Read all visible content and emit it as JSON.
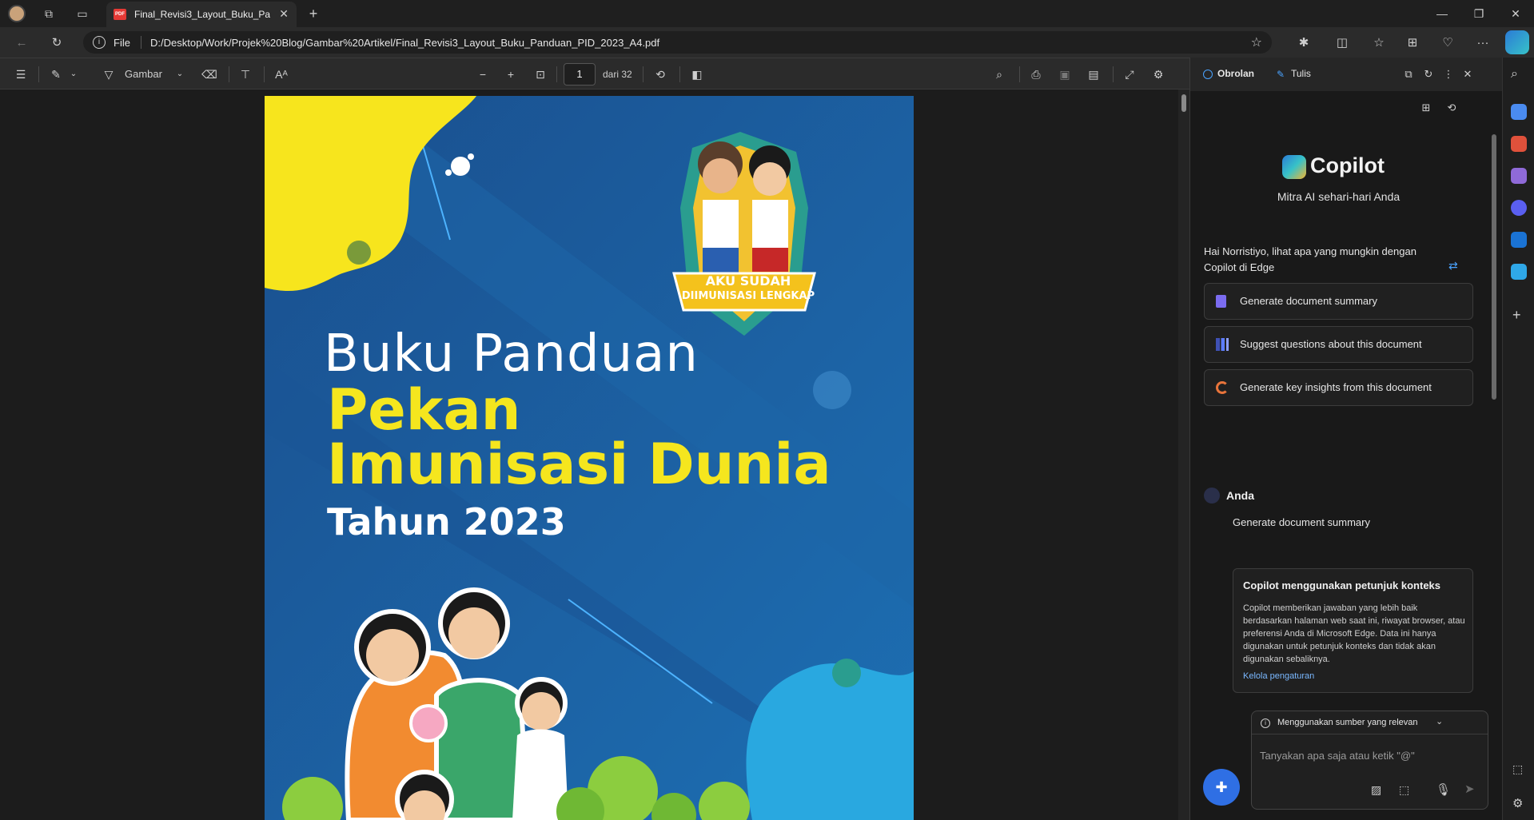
{
  "browser": {
    "tab_title": "Final_Revisi3_Layout_Buku_Panduan_PID_2023_A4.pdf",
    "address_scheme": "File",
    "address_url": "D:/Desktop/Work/Projek%20Blog/Gambar%20Artikel/Final_Revisi3_Layout_Buku_Panduan_PID_2023_A4.pdf"
  },
  "pdf_toolbar": {
    "draw_label": "Gambar",
    "page_current": "1",
    "page_total_label": "dari 32"
  },
  "pdf_page": {
    "title_line1": "Buku Panduan",
    "title_line2": "Pekan",
    "title_line3": "Imunisasi Dunia",
    "title_line4": "Tahun 2023",
    "badge_line1": "AKU SUDAH",
    "badge_line2": "DIIMUNISASI LENGKAP"
  },
  "copilot": {
    "tab_chat": "Obrolan",
    "tab_write": "Tulis",
    "brand": "Copilot",
    "tagline": "Mitra AI sehari-hari Anda",
    "greeting": "Hai Norristiyo, lihat apa yang mungkin dengan Copilot di Edge",
    "suggestions": [
      "Generate document summary",
      "Suggest questions about this document",
      "Generate key insights from this document"
    ],
    "user_name": "Anda",
    "user_message": "Generate document summary",
    "context_title": "Copilot menggunakan petunjuk konteks",
    "context_body": "Copilot memberikan jawaban yang lebih baik berdasarkan halaman web saat ini, riwayat browser, atau preferensi Anda di Microsoft Edge. Data ini hanya digunakan untuk petunjuk konteks dan tidak akan digunakan sebaliknya.",
    "context_link": "Kelola pengaturan",
    "source_selector": "Menggunakan sumber yang relevan",
    "input_placeholder": "Tanyakan apa saja atau ketik \"@\""
  },
  "colors": {
    "accent": "#4aa3ff",
    "page_blue": "#1b5fa0",
    "title_yellow": "#f5e61e"
  }
}
